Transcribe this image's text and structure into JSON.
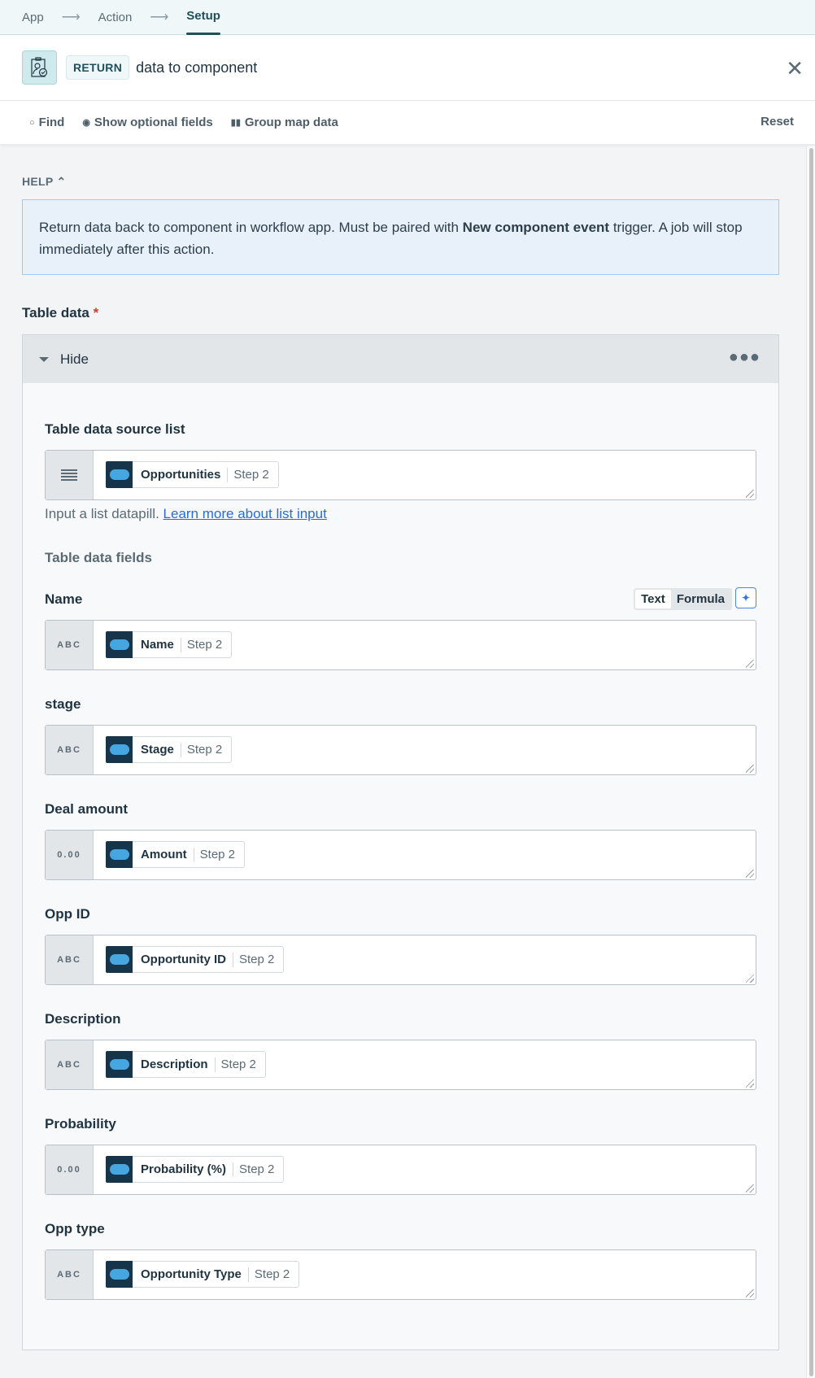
{
  "breadcrumb": {
    "items": [
      "App",
      "Action",
      "Setup"
    ],
    "separator": "⟶"
  },
  "header": {
    "badge": "RETURN",
    "title": "data to component"
  },
  "toolbar": {
    "find": "Find",
    "optional": "Show optional fields",
    "group": "Group map data",
    "reset": "Reset"
  },
  "help": {
    "label": "HELP",
    "text_before": "Return data back to component in workflow app. Must be paired with ",
    "text_bold": "New component event",
    "text_after": " trigger. A job will stop immediately after this action."
  },
  "table_data": {
    "label": "Table data",
    "required": "*",
    "toggle": "Hide",
    "source": {
      "label": "Table data source list",
      "pill": "Opportunities",
      "step": "Step 2",
      "hint": "Input a list datapill. ",
      "link": "Learn more about list input"
    },
    "fields_label": "Table data fields",
    "mode": {
      "text": "Text",
      "formula": "Formula"
    },
    "fields": [
      {
        "label": "Name",
        "type": "ABC",
        "pill": "Name",
        "step": "Step 2"
      },
      {
        "label": "stage",
        "type": "ABC",
        "pill": "Stage",
        "step": "Step 2"
      },
      {
        "label": "Deal amount",
        "type": "0.00",
        "pill": "Amount",
        "step": "Step 2"
      },
      {
        "label": "Opp ID",
        "type": "ABC",
        "pill": "Opportunity ID",
        "step": "Step 2"
      },
      {
        "label": "Description",
        "type": "ABC",
        "pill": "Description",
        "step": "Step 2"
      },
      {
        "label": "Probability",
        "type": "0.00",
        "pill": "Probability (%)",
        "step": "Step 2"
      },
      {
        "label": "Opp type",
        "type": "ABC",
        "pill": "Opportunity Type",
        "step": "Step 2"
      }
    ]
  }
}
